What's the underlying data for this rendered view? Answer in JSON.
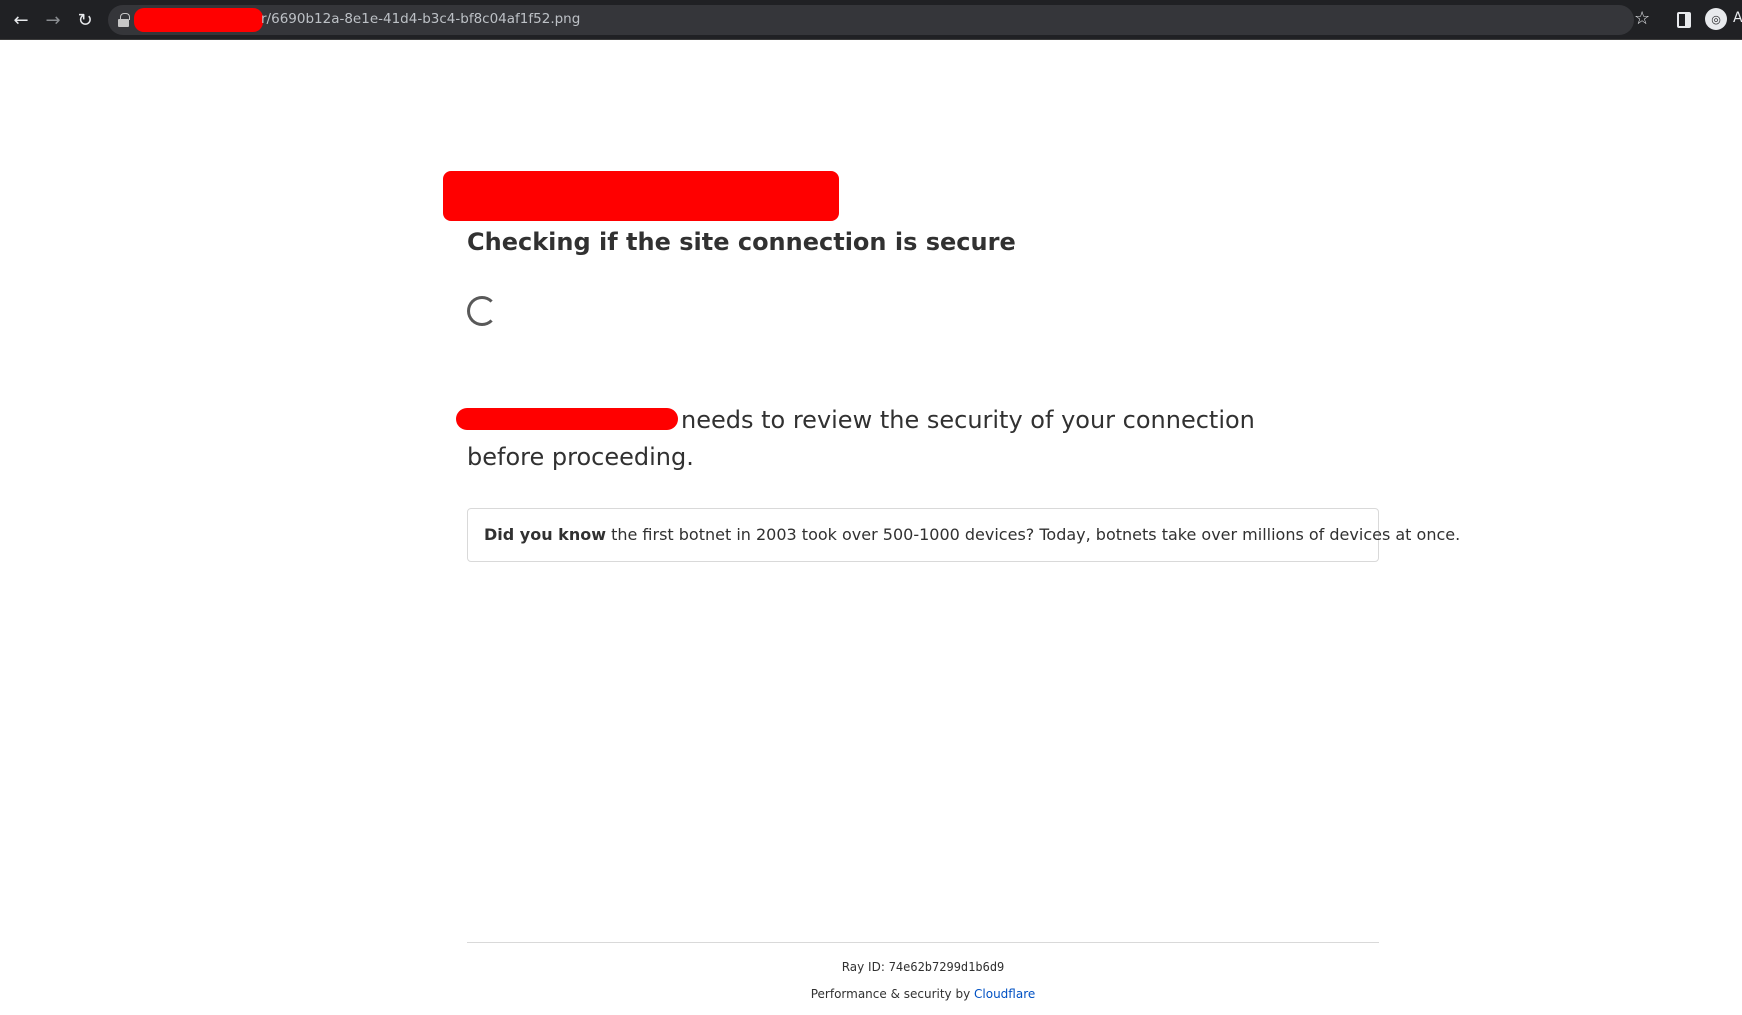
{
  "browser": {
    "url_text": "r/6690b12a-8e1e-41d4-b3c4-bf8c04af1f52.png",
    "profile_letter": "A",
    "icons": [
      "back-arrow-icon",
      "forward-arrow-icon",
      "reload-icon",
      "lock-icon",
      "star-icon",
      "side-panel-icon",
      "incognito-avatar-icon"
    ]
  },
  "page": {
    "title": "Checking if the site connection is secure",
    "review_text": "needs to review the security of your connection before proceeding.",
    "did_you_know_label": "Did you know",
    "did_you_know_text": " the first botnet in 2003 took over 500-1000 devices? Today, botnets take over millions of devices at once."
  },
  "footer": {
    "ray_label": "Ray ID: ",
    "ray_id": "74e62b7299d1b6d9",
    "performance_label": "Performance & security by ",
    "cloudflare_link": "Cloudflare"
  },
  "colors": {
    "redaction": "#ff0000",
    "link": "#0051c3",
    "text": "#313131"
  }
}
